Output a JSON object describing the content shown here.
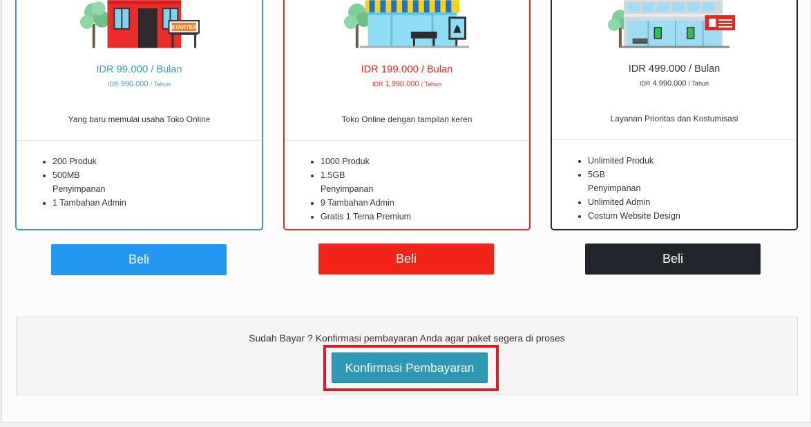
{
  "colors": {
    "starter": "#3a97d4",
    "pro": "#e8271c",
    "business": "#252525",
    "confirm_button": "#2f98b5",
    "highlight": "#d61e2a"
  },
  "plans": [
    {
      "illustration": "starter-shop-icon",
      "sign_text": "STARTER",
      "currency_main": "IDR",
      "price_monthly": "99.000",
      "per_month": "/ Bulan",
      "currency_sub": "IDR",
      "price_yearly": "990.000",
      "per_year": "/ Tahun",
      "description": "Yang baru memulai usaha Toko Online",
      "features": [
        "200 Produk",
        "500MB Penyimpanan",
        "1 Tambahan Admin"
      ],
      "buy_label": "Beli"
    },
    {
      "illustration": "storefront-icon",
      "currency_main": "IDR",
      "price_monthly": "199.000",
      "per_month": "/ Bulan",
      "currency_sub": "IDR",
      "price_yearly": "1.990.000",
      "per_year": "/ Tahun",
      "description": "Toko Online dengan tampilan keren",
      "features": [
        "1000 Produk",
        "1.5GB Penyimpanan",
        "9 Tambahan Admin",
        "Gratis 1 Tema Premium"
      ],
      "buy_label": "Beli"
    },
    {
      "illustration": "mall-building-icon",
      "currency_main": "IDR",
      "price_monthly": "499.000",
      "per_month": "/ Bulan",
      "currency_sub": "IDR",
      "price_yearly": "4.990.000",
      "per_year": "/ Tahun",
      "description": "Layanan Prioritas dan Kostumisasi",
      "features": [
        "Unlimited Produk",
        "5GB Penyimpanan",
        "Unlimited Admin",
        "Costum Website Design"
      ],
      "buy_label": "Beli"
    }
  ],
  "confirmation": {
    "prompt": "Sudah Bayar ? Konfirmasi pembayaran Anda agar paket segera di proses",
    "button_label": "Konfirmasi Pembayaran"
  }
}
